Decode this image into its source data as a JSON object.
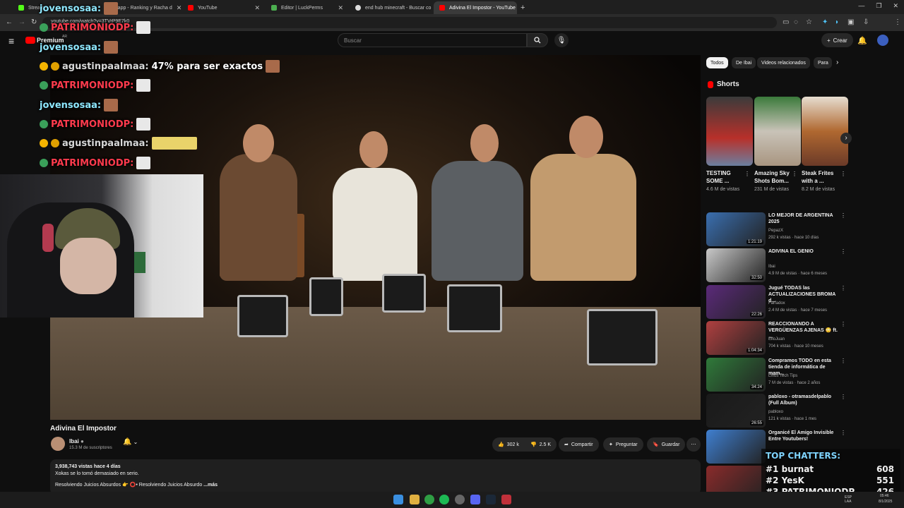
{
  "browser": {
    "tabs": [
      {
        "label": "Stream",
        "active": false
      },
      {
        "label": "statecapp - Ranking y Racha d",
        "active": false
      },
      {
        "label": "YouTube",
        "active": false
      },
      {
        "label": "Editor | LuckPerms",
        "active": false
      },
      {
        "label": "end hub minecraft - Buscar co",
        "active": false
      },
      {
        "label": "Adivina El Impostor - YouTube",
        "active": true
      }
    ],
    "url": "youtube.com/watch?v=3TVrP9E7k0",
    "new_tab_symbol": "+",
    "close_symbol": "✕"
  },
  "youtube": {
    "logo_text": "Premium",
    "logo_suffix": "AR",
    "search_placeholder": "Buscar",
    "create_label": "Crear"
  },
  "chat_overlay": [
    {
      "user": "jovensosaa:",
      "color": "#8fe8ff",
      "msg": ""
    },
    {
      "user": "PATRIMONIODP:",
      "color": "#ff3b4d",
      "msg": ""
    },
    {
      "user": "jovensosaa:",
      "color": "#8fe8ff",
      "msg": ""
    },
    {
      "user": "agustinpaalmaa:",
      "color": "#d8d8d8",
      "msg": "47% para ser exactos"
    },
    {
      "user": "PATRIMONIODP:",
      "color": "#ff3b4d",
      "msg": ""
    },
    {
      "user": "jovensosaa:",
      "color": "#8fe8ff",
      "msg": ""
    },
    {
      "user": "PATRIMONIODP:",
      "color": "#ff3b4d",
      "msg": ""
    },
    {
      "user": "agustinpaalmaa:",
      "color": "#d8d8d8",
      "msg": ""
    },
    {
      "user": "PATRIMONIODP:",
      "color": "#ff3b4d",
      "msg": ""
    }
  ],
  "video": {
    "title": "Adivina El Impostor",
    "channel": "Ibai",
    "subscribers": "15.3 M de suscriptores",
    "likes": "302 k",
    "dislikes": "2.5 K",
    "share_label": "Compartir",
    "ask_label": "Preguntar",
    "save_label": "Guardar",
    "desc_stats": "3,938,743 vistas  hace 4 días",
    "desc_line1": "Xokas se lo tomó demasiado en serio.",
    "desc_line2": "Resolviendo Juicios Absurdos 👉 ⭕• Resolviendo Juicios Absurdo",
    "desc_more": "...más"
  },
  "sidebar": {
    "chips": [
      "Todos",
      "De Ibai",
      "Videos relacionados",
      "Para"
    ],
    "shorts_heading": "Shorts",
    "shorts": [
      {
        "title": "TESTING SOME ...",
        "views": "4.6 M de vistas"
      },
      {
        "title": "Amazing Sky Shots Bom...",
        "views": "231 M de vistas"
      },
      {
        "title": "Steak Frites with a ...",
        "views": "8.2 M de vistas"
      }
    ],
    "recommended": [
      {
        "title": "LO MEJOR DE ARGENTINA 2025",
        "channel": "PepazX",
        "meta": "292 k vistas · hace 10 días",
        "duration": "1:21:19",
        "color": "#3a6fb0"
      },
      {
        "title": "ADIVINA EL GENIO",
        "channel": "Ibai",
        "meta": "4.9 M de vistas · hace 6 meses",
        "duration": "32:50",
        "color": "#c9c9c9"
      },
      {
        "title": "Jugué TODAS las ACTUALIZACIONES BROMA d...",
        "channel": "Farfadox",
        "meta": "2.4 M de vistas · hace 7 meses",
        "duration": "22:26",
        "color": "#5b2a7a"
      },
      {
        "title": "REACCIONANDO A VERGÜENZAS AJENAS 😳 ft. ...",
        "channel": "ElloJuan",
        "meta": "704 k vistas · hace 10 meses",
        "duration": "1:04:34",
        "color": "#b04040"
      },
      {
        "title": "Compramos TODO en esta tienda de informática de mam...",
        "channel": "Linus Tech Tips",
        "meta": "7 M de vistas · hace 2 años",
        "duration": "34:24",
        "color": "#2f7a3a"
      },
      {
        "title": "pabloxo - otramasdelpablo (Full Album)",
        "channel": "pabloxo",
        "meta": "121 k vistas · hace 1 mes",
        "duration": "26:55",
        "color": "#1a1a1a"
      },
      {
        "title": "Organicé El Amigo Invisible Entre Youtubers!",
        "channel": "",
        "meta": "",
        "duration": "",
        "color": "#3f7fd0"
      },
      {
        "title": "",
        "channel": "",
        "meta": "",
        "duration": "",
        "color": "#8a2b2b"
      }
    ]
  },
  "top_chatters": {
    "title": "TOP CHATTERS:",
    "rows": [
      {
        "rank": "#1",
        "name": "burnat",
        "count": "608"
      },
      {
        "rank": "#2",
        "name": "YesK",
        "count": "551"
      },
      {
        "rank": "#3",
        "name": "PATRIMONIODP",
        "count": "426"
      }
    ]
  },
  "taskbar": {
    "lang": "ESP\nLAA",
    "time": "05:46",
    "date": "8/1/2025"
  }
}
